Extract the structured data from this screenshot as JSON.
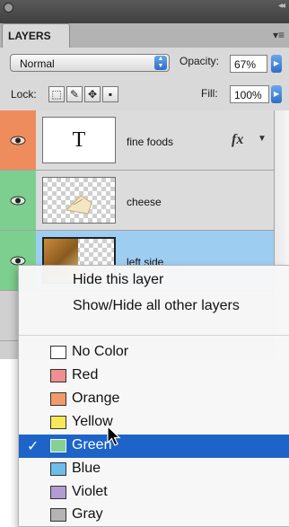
{
  "panel": {
    "tab_label": "LAYERS",
    "blend_mode": "Normal",
    "opacity_label": "Opacity:",
    "opacity_value": "67%",
    "lock_label": "Lock:",
    "fill_label": "Fill:",
    "fill_value": "100%"
  },
  "layers": [
    {
      "name": "fine foods",
      "thumb_text": "T",
      "fx": "fx",
      "color": "#ef8c5e"
    },
    {
      "name": "cheese",
      "color": "#7dcf8f"
    },
    {
      "name": "left side",
      "color": "#7dcf8f"
    }
  ],
  "menu": {
    "hide_layer": "Hide this layer",
    "show_hide_others": "Show/Hide all other layers",
    "colors": [
      {
        "label": "No Color",
        "swatch": "#ffffff"
      },
      {
        "label": "Red",
        "swatch": "#f08f8f"
      },
      {
        "label": "Orange",
        "swatch": "#f19a6c"
      },
      {
        "label": "Yellow",
        "swatch": "#f7e85a"
      },
      {
        "label": "Green",
        "swatch": "#86cf95",
        "selected": true
      },
      {
        "label": "Blue",
        "swatch": "#6fbde8"
      },
      {
        "label": "Violet",
        "swatch": "#b29cd3"
      },
      {
        "label": "Gray",
        "swatch": "#b4b4b4"
      }
    ],
    "check_mark": "✓"
  }
}
